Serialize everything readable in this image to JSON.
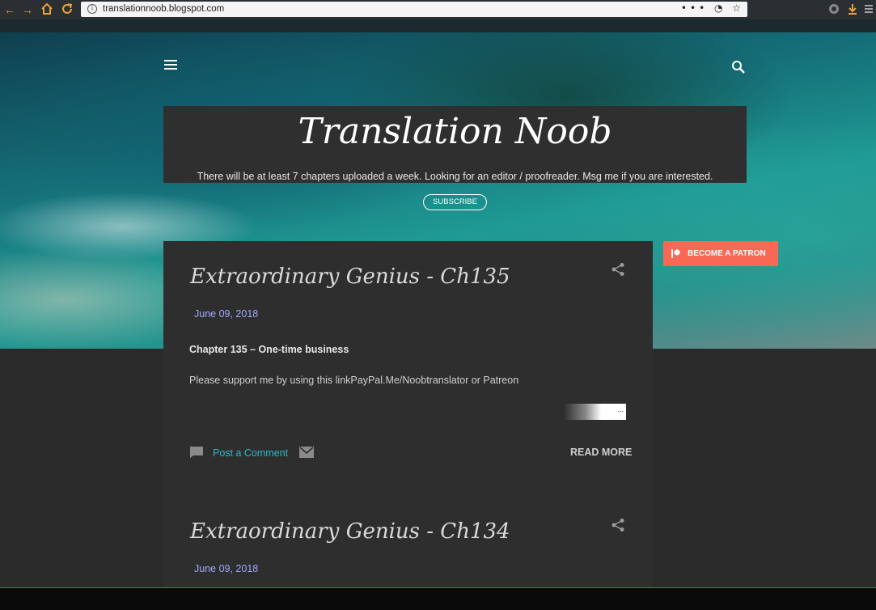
{
  "browser": {
    "url": "translationnoob.blogspot.com",
    "address_icons": "••• ◔ ☆"
  },
  "header": {
    "blog_title": "Translation Noob",
    "description": "There will be at least 7 chapters uploaded a week. Looking for an editor / proofreader. Msg me if you are interested.",
    "subscribe_label": "SUBSCRIBE"
  },
  "sidebar": {
    "patron_label": "BECOME A PATRON"
  },
  "posts": [
    {
      "title": "Extraordinary Genius - Ch135",
      "date": "June 09, 2018",
      "subtitle": "Chapter 135 – One-time business",
      "body": "Please support me by using this linkPayPal.Me/Noobtranslator or Patreon",
      "image_label": "...",
      "comment_label": "Post a Comment",
      "read_more_label": "READ MORE"
    },
    {
      "title": "Extraordinary Genius - Ch134",
      "date": "June 09, 2018"
    }
  ],
  "colors": {
    "patron": "#f96854",
    "link": "#2ab8c9",
    "date": "#9fa8ff",
    "card": "#2e2e2e"
  }
}
